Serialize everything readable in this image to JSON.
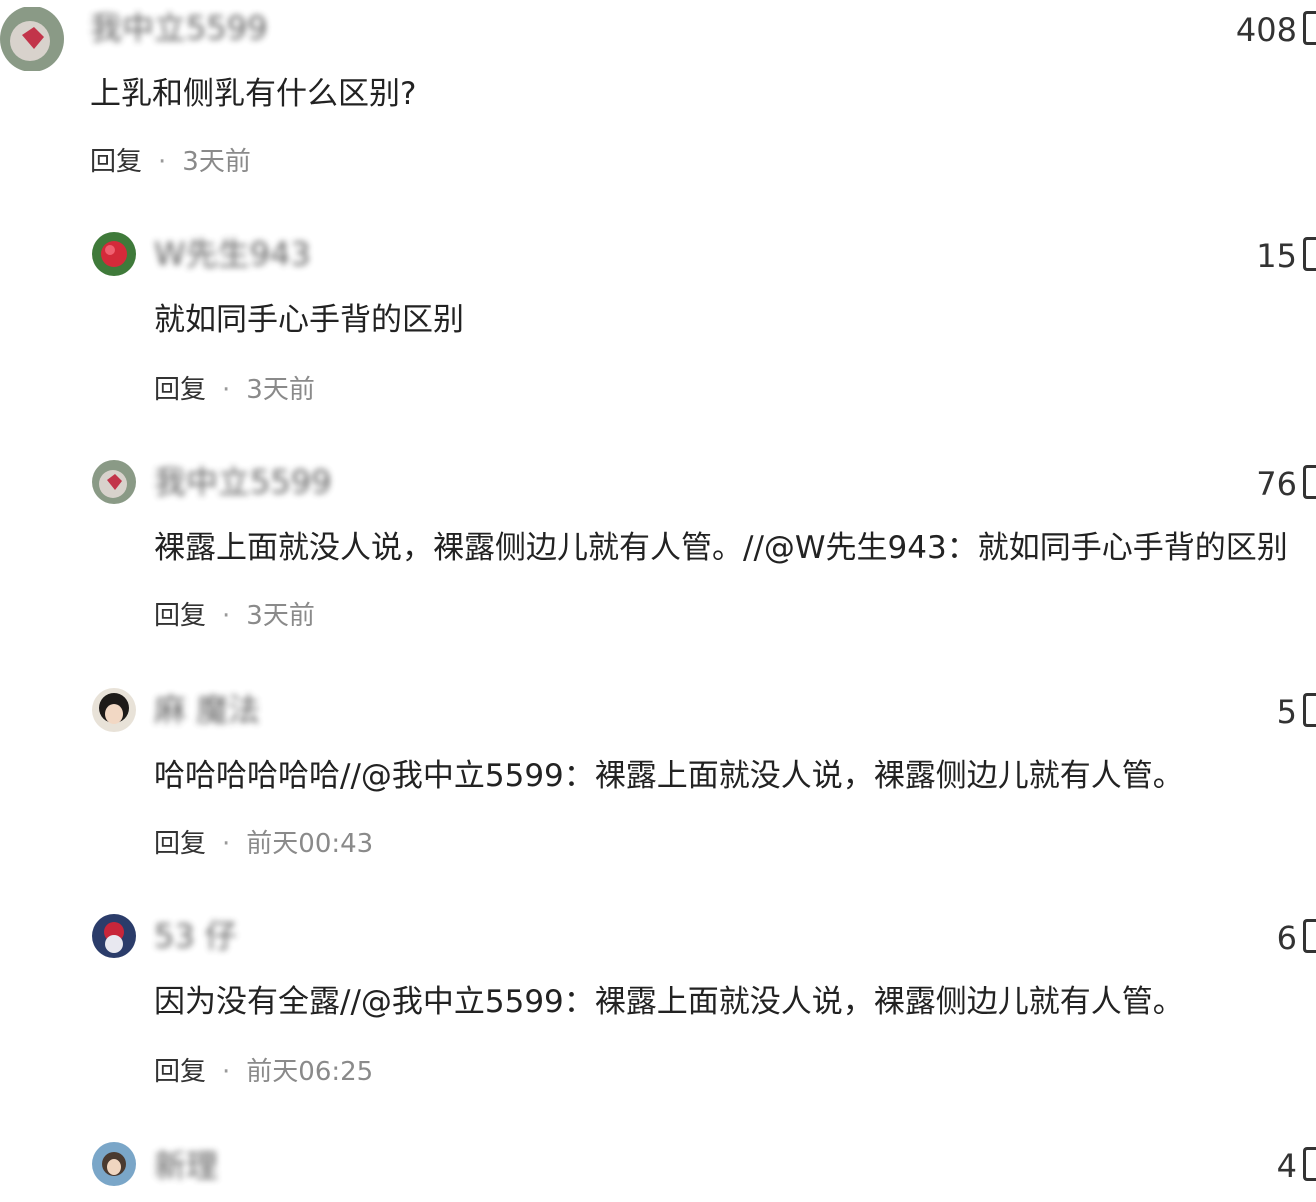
{
  "comments": [
    {
      "username": "我中立5599",
      "likes": "408",
      "content": "上乳和侧乳有什么区别?",
      "reply_label": "回复",
      "separator": "·",
      "time": "3天前"
    },
    {
      "username": "W先生943",
      "likes": "15",
      "content": "就如同手心手背的区别",
      "reply_label": "回复",
      "separator": "·",
      "time": "3天前"
    },
    {
      "username": "我中立5599",
      "likes": "76",
      "content": "裸露上面就没人说，裸露侧边儿就有人管。//@W先生943：就如同手心手背的区别",
      "reply_label": "回复",
      "separator": "·",
      "time": "3天前"
    },
    {
      "username": "麻 魔法",
      "likes": "5",
      "content": "哈哈哈哈哈哈//@我中立5599：裸露上面就没人说，裸露侧边儿就有人管。",
      "reply_label": "回复",
      "separator": "·",
      "time": "前天00:43"
    },
    {
      "username": "53 仔",
      "likes": "6",
      "content": "因为没有全露//@我中立5599：裸露上面就没人说，裸露侧边儿就有人管。",
      "reply_label": "回复",
      "separator": "·",
      "time": "前天06:25"
    },
    {
      "username": "新理",
      "likes": "4",
      "content": "",
      "reply_label": "",
      "separator": "",
      "time": ""
    }
  ],
  "colors": {
    "text": "#222222",
    "meta": "#8a8a8a",
    "background": "#ffffff"
  }
}
